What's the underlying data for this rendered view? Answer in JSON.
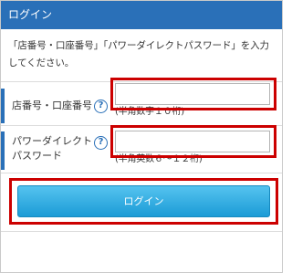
{
  "header": {
    "title": "ログイン"
  },
  "instructions": "「店番号・口座番号」「パワーダイレクトパスワード」を入力してください。",
  "fields": [
    {
      "label": "店番号・口座番号",
      "help": "?",
      "value": "",
      "hint": "(半角数字１０桁)"
    },
    {
      "label_line1": "パワーダイレクト",
      "label_line2": "パスワード",
      "help": "?",
      "value": "",
      "hint": "(半角英数６～１２桁)"
    }
  ],
  "login_button": {
    "label": "ログイン"
  },
  "colors": {
    "header": "#2a70b8",
    "highlight": "#cc0000",
    "button": "#1b9bd6"
  }
}
